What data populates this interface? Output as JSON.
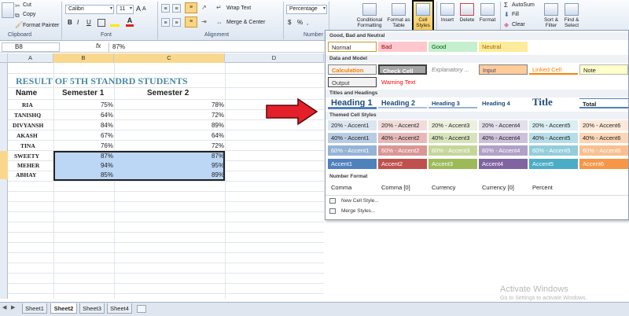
{
  "ribbon": {
    "clipboard": {
      "cut": "Cut",
      "copy": "Copy",
      "format_painter": "Format Painter",
      "label": "Clipboard"
    },
    "font": {
      "name": "Calibri",
      "size": "11",
      "grow": "A",
      "shrink": "A",
      "bold": "B",
      "italic": "I",
      "underline": "U",
      "label": "Font"
    },
    "alignment": {
      "wrap_text": "Wrap Text",
      "merge_center": "Merge & Center",
      "label": "Alignment"
    },
    "number": {
      "format": "Percentage",
      "label": "Number",
      "currency": "$",
      "percent": "%",
      "comma": ","
    },
    "styles": {
      "conditional": "Conditional Formatting",
      "format_table": "Format as Table",
      "cell_styles": "Cell Styles"
    },
    "cells": {
      "insert": "Insert",
      "delete": "Delete",
      "format": "Format"
    },
    "editing": {
      "autosum": "AutoSum",
      "fill": "Fill",
      "clear": "Clear",
      "sort": "Sort & Filter",
      "find": "Find & Select"
    }
  },
  "formula_bar": {
    "name_box": "B8",
    "fx": "fx",
    "value": "87%"
  },
  "sheet": {
    "columns": [
      "A",
      "B",
      "C",
      "D"
    ],
    "title": "RESULT OF 5TH STANDRD STUDENTS",
    "headers": [
      "Name",
      "Semester 1",
      "Semester 2"
    ],
    "rows": [
      {
        "name": "RIA",
        "s1": "75%",
        "s2": "78%"
      },
      {
        "name": "TANISHQ",
        "s1": "64%",
        "s2": "72%"
      },
      {
        "name": "DIVYANSH",
        "s1": "84%",
        "s2": "89%"
      },
      {
        "name": "AKASH",
        "s1": "67%",
        "s2": "64%"
      },
      {
        "name": "TINA",
        "s1": "76%",
        "s2": "72%"
      },
      {
        "name": "SWEETY",
        "s1": "87%",
        "s2": "87%"
      },
      {
        "name": "MEHER",
        "s1": "94%",
        "s2": "95%"
      },
      {
        "name": "ABHAY",
        "s1": "85%",
        "s2": "89%"
      }
    ]
  },
  "tabs": [
    "Sheet1",
    "Sheet2",
    "Sheet3",
    "Sheet4"
  ],
  "active_tab": "Sheet2",
  "gallery": {
    "sections": [
      "Good, Bad and Neutral",
      "Data and Model",
      "Titles and Headings",
      "Themed Cell Styles",
      "Number Format"
    ],
    "good_bad": [
      "Normal",
      "Bad",
      "Good",
      "Neutral"
    ],
    "data_model": [
      "Calculation",
      "Check Cell",
      "Explanatory ...",
      "Input",
      "Linked Cell",
      "Note",
      "Output",
      "Warning Text"
    ],
    "titles": [
      "Heading 1",
      "Heading 2",
      "Heading 3",
      "Heading 4",
      "Title",
      "Total"
    ],
    "accent20": [
      "20% - Accent1",
      "20% - Accent2",
      "20% - Accent3",
      "20% - Accent4",
      "20% - Accent5",
      "20% - Accent6"
    ],
    "accent40": [
      "40% - Accent1",
      "40% - Accent2",
      "40% - Accent3",
      "40% - Accent4",
      "40% - Accent5",
      "40% - Accent6"
    ],
    "accent60": [
      "60% - Accent1",
      "60% - Accent2",
      "60% - Accent3",
      "60% - Accent4",
      "60% - Accent5",
      "60% - Accent6"
    ],
    "accent": [
      "Accent1",
      "Accent2",
      "Accent3",
      "Accent4",
      "Accent5",
      "Accent6"
    ],
    "number": [
      "Comma",
      "Comma [0]",
      "Currency",
      "Currency [0]",
      "Percent"
    ],
    "menu": [
      "New Cell Style...",
      "Merge Styles..."
    ]
  },
  "watermark": {
    "line1": "Activate Windows",
    "line2": "Go to Settings to activate Windows."
  },
  "colors": {
    "accent_title": "#4a8ba8",
    "selection": "#bcd7f5",
    "arrow": "#e3202a"
  }
}
